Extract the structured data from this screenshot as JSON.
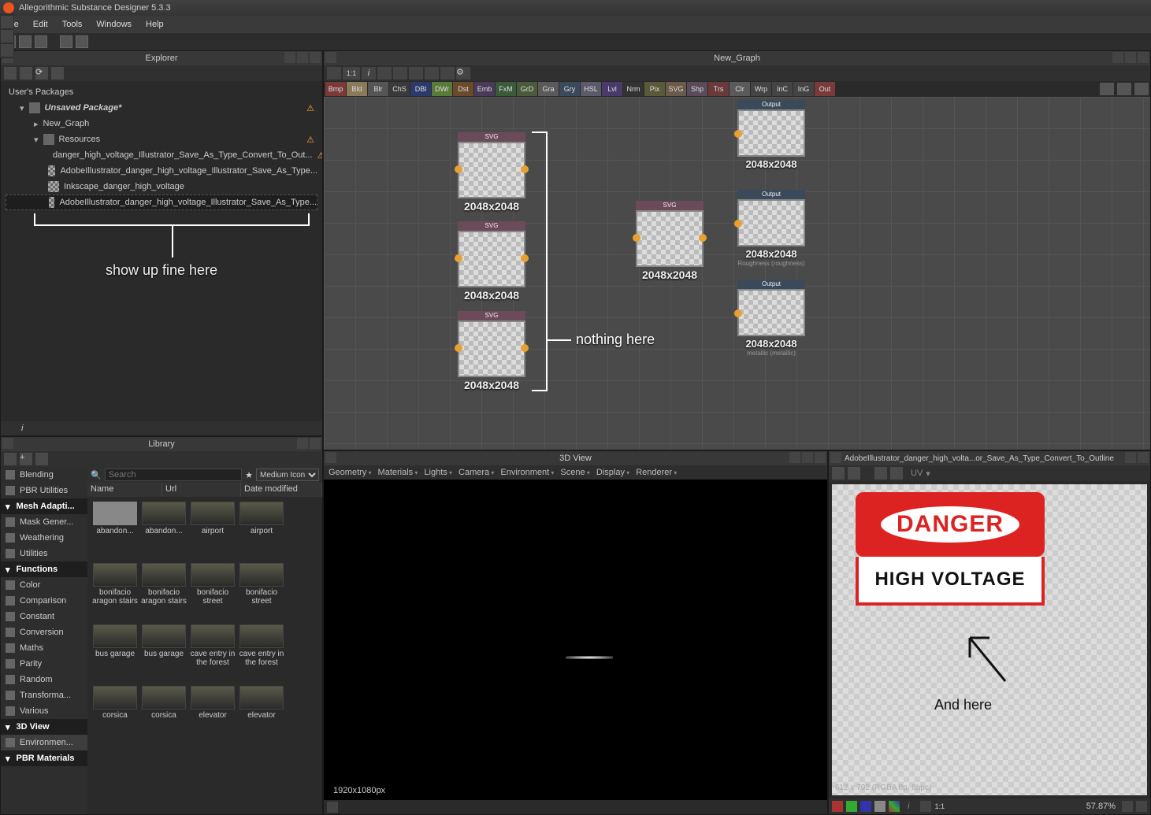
{
  "app": {
    "title": "Allegorithmic Substance Designer 5.3.3"
  },
  "menu": {
    "file": "File",
    "edit": "Edit",
    "tools": "Tools",
    "windows": "Windows",
    "help": "Help"
  },
  "explorer": {
    "title": "Explorer",
    "header": "User's Packages",
    "package": "Unsaved Package*",
    "graph": "New_Graph",
    "resources": "Resources",
    "items": [
      "danger_high_voltage_Illustrator_Save_As_Type_Convert_To_Out...",
      "AdobeIllustrator_danger_high_voltage_Illustrator_Save_As_Type...",
      "Inkscape_danger_high_voltage",
      "AdobeIllustrator_danger_high_voltage_Illustrator_Save_As_Type..."
    ],
    "annotation": "show up fine here"
  },
  "library": {
    "title": "Library",
    "search_placeholder": "Search",
    "view_mode": "Medium Icon",
    "columns": {
      "name": "Name",
      "url": "Url",
      "date": "Date modified"
    },
    "cats": [
      {
        "label": "Blending",
        "kind": "item"
      },
      {
        "label": "PBR Utilities",
        "kind": "item"
      },
      {
        "label": "Mesh Adapti...",
        "kind": "hdr"
      },
      {
        "label": "Mask Gener...",
        "kind": "item"
      },
      {
        "label": "Weathering",
        "kind": "item"
      },
      {
        "label": "Utilities",
        "kind": "item"
      },
      {
        "label": "Functions",
        "kind": "hdr"
      },
      {
        "label": "Color",
        "kind": "item"
      },
      {
        "label": "Comparison",
        "kind": "item"
      },
      {
        "label": "Constant",
        "kind": "item"
      },
      {
        "label": "Conversion",
        "kind": "item"
      },
      {
        "label": "Maths",
        "kind": "item"
      },
      {
        "label": "Parity",
        "kind": "item"
      },
      {
        "label": "Random",
        "kind": "item"
      },
      {
        "label": "Transforma...",
        "kind": "item"
      },
      {
        "label": "Various",
        "kind": "item"
      },
      {
        "label": "3D View",
        "kind": "hdr"
      },
      {
        "label": "Environmen...",
        "kind": "sel"
      },
      {
        "label": "PBR Materials",
        "kind": "hdr"
      }
    ],
    "thumbs": [
      "abandon...",
      "abandon...",
      "airport",
      "airport",
      "bonifacio aragon stairs",
      "bonifacio aragon stairs",
      "bonifacio street",
      "bonifacio street",
      "bus garage",
      "bus garage",
      "cave entry in the forest",
      "cave entry in the forest",
      "corsica",
      "corsica",
      "elevator",
      "elevator"
    ]
  },
  "graph": {
    "title": "New_Graph",
    "filters": [
      "Bmp",
      "Bld",
      "Blr",
      "ChS",
      "DBl",
      "DWr",
      "Dst",
      "Emb",
      "FxM",
      "GrD",
      "Gra",
      "Gry",
      "HSL",
      "Lvl",
      "Nrm",
      "Pix",
      "SVG",
      "Shp",
      "Trs",
      "Clr",
      "Wrp",
      "InC",
      "InG",
      "Out"
    ],
    "size_label": "2048x2048",
    "svg_label": "SVG",
    "output_label": "Output",
    "sub_rough": "Roughness (roughness)",
    "sub_metal": "metallic (metallic)",
    "annotation": "nothing here"
  },
  "view3d": {
    "title": "3D View",
    "menus": [
      "Geometry",
      "Materials",
      "Lights",
      "Camera",
      "Environment",
      "Scene",
      "Display",
      "Renderer"
    ],
    "resolution": "1920x1080px"
  },
  "view2d": {
    "title": "AdobeIllustrator_danger_high_volta...or_Save_As_Type_Convert_To_Outline",
    "uv": "UV",
    "sign_top": "DANGER",
    "sign_bottom": "HIGH VOLTAGE",
    "dim": "612 x 792 (RGBA 8p, 8bpc)",
    "annotation": "And here",
    "zoom": "57.87%",
    "zoom_ratio": "1:1"
  }
}
